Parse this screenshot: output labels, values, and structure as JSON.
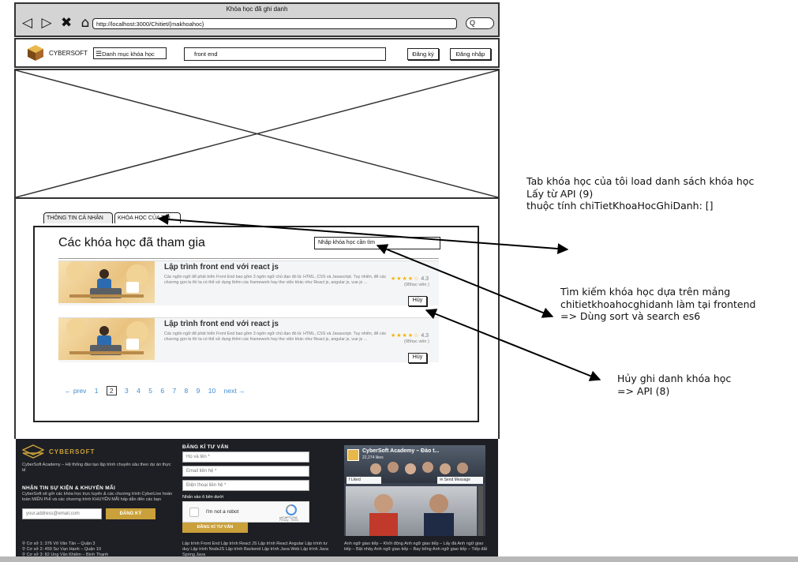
{
  "browser": {
    "window_title": "Khóa học đã ghi danh",
    "nav_icons": "◁ ▷ ✖ ⌂",
    "url": "http://localhost:3000/Chitiet/{makhoahoc}",
    "search_icon": "Q"
  },
  "header": {
    "brand": "CYBERSOFT",
    "category_button": "Danh mục khóa học",
    "search_value": "front end",
    "register_button": "Đăng ký",
    "login_button": "Đăng nhập"
  },
  "tabs": [
    {
      "label": "THÔNG TIN CÁ NHÂN"
    },
    {
      "label": "KHÓA HỌC CỦA TÔI"
    }
  ],
  "panel": {
    "title": "Các khóa học đã tham gia",
    "search_placeholder": "Nhập khóa học cần tìm"
  },
  "courses": [
    {
      "title": "Lập trình front end với react js",
      "description": "Các ngôn ngữ để phát triển Front End bao gồm 3 ngôn ngữ chủ đạo đó là: HTML, CSS và Javascript. Tuy nhiên, để các chương gọn lẹ thì ta có thể sử dụng thêm các framework hay thư viện khác như React js, angular js, vue js ...",
      "stars": "★★★★☆",
      "rating": "4.3",
      "views": "(95học viên )",
      "cancel_label": "Hủy"
    },
    {
      "title": "Lập trình front end với react js",
      "description": "Các ngôn ngữ để phát triển Front End bao gồm 3 ngôn ngữ chủ đạo đó là: HTML, CSS và Javascript. Tuy nhiên, để các chương gọn lẹ thì ta có thể sử dụng thêm các framework hay thư viện khác như React js, angular js, vue js ...",
      "stars": "★★★★☆",
      "rating": "4.3",
      "views": "(95học viên )",
      "cancel_label": "Hủy"
    }
  ],
  "pagination": {
    "prev": "← prev",
    "pages": [
      "1",
      "2",
      "3",
      "4",
      "5",
      "6",
      "7",
      "8",
      "9",
      "10"
    ],
    "current": "2",
    "next": "next →"
  },
  "footer": {
    "brand": "CYBERSOFT",
    "about": "CyberSoft Academy – Hệ thống đào tạo lập trình chuyên sâu theo dự án thực tế",
    "news_title": "NHẬN TIN SỰ KIỆN & KHUYẾN MÃI",
    "news_text": "CyberSoft sẽ gởi các khóa học trực tuyến & các chương trình CyberLive hoàn toàn MIỄN PHÍ và các chương trình KHUYẾN MÃI hấp dẫn đến các bạn",
    "email_placeholder": "your.address@email.com",
    "subscribe_button": "ĐĂNG KÝ",
    "consult_title": "ĐĂNG KÍ TƯ VẤN",
    "name_placeholder": "Họ và tên *",
    "email_contact_placeholder": "Email liên hệ *",
    "phone_placeholder": "Điện thoại liên hệ *",
    "captcha_prompt": "Nhấn vào ô bên dưới",
    "captcha_label": "I'm not a robot",
    "captcha_brand": "reCAPTCHA",
    "captcha_terms": "Privacy - Terms",
    "consult_button": "ĐĂNG KÍ TƯ VẤN",
    "fb_page_name": "CyberSoft Academy – Đào t...",
    "fb_likes": "22,274 likes",
    "fb_liked": "Liked",
    "fb_send": "Send Message",
    "addresses": [
      "Cơ sở 1: 376 Võ Văn Tần – Quận 3",
      "Cơ sở 2: 459 Sư Vạn Hạnh – Quận 10",
      "Cơ sở 3: 82 Ung Văn Khiêm – Bình Thạnh"
    ],
    "courses_links": "Lập trình Front End   Lập trình React JS   Lập trình React Angular   Lập trình tư duy   Lập trình NodeJS   Lập trình Backend   Lập trình Java Web   Lập trình Java Spring   Java",
    "english_links": "Anh ngữ giao tiếp – Khởi động Anh ngữ giao tiếp – Lấy đà Anh ngữ giao tiếp – Bật nhảy Anh ngữ giao tiếp – Bay bổng Anh ngữ giao tiếp – Tiếp đất"
  },
  "annotations": [
    {
      "lines": [
        "Tab khóa học của tôi load danh sách khóa học",
        "Lấy từ API (9)",
        "thuộc tính chiTietKhoaHocGhiDanh: []"
      ]
    },
    {
      "lines": [
        "Tìm kiếm khóa học dựa trên mảng",
        "chitietkhoahocghidanh làm tại frontend",
        "=> Dùng sort và search es6"
      ]
    },
    {
      "lines": [
        "Hủy ghi danh khóa học",
        "=> API (8)"
      ]
    }
  ]
}
